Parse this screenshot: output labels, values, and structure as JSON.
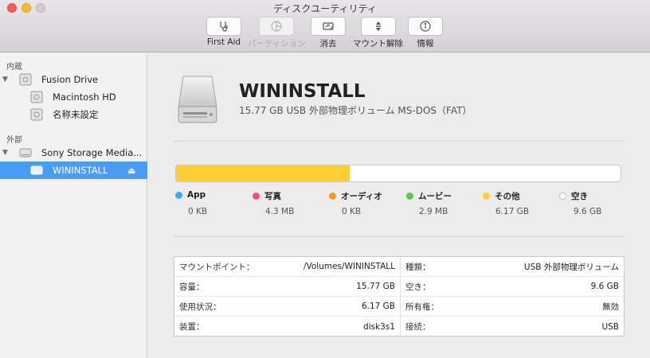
{
  "window": {
    "title": "ディスクユーティリティ"
  },
  "toolbar": {
    "first_aid": "First Aid",
    "partition": "パーティション",
    "erase": "消去",
    "unmount": "マウント解除",
    "info": "情報"
  },
  "sidebar": {
    "internal_label": "内蔵",
    "external_label": "外部",
    "items": [
      {
        "label": "Fusion Drive"
      },
      {
        "label": "Macintosh HD"
      },
      {
        "label": "名称未設定"
      },
      {
        "label": "Sony Storage Media..."
      },
      {
        "label": "WININSTALL"
      }
    ]
  },
  "volume": {
    "name": "WININSTALL",
    "subtitle": "15.77 GB USB 外部物理ボリューム MS-DOS（FAT）"
  },
  "usage": {
    "used_fraction": 0.39,
    "colors": {
      "app": "#3ea9f5",
      "photos": "#f24d82",
      "audio": "#f79a1c",
      "movies": "#5ec84c",
      "other": "#fecf34",
      "free": "#ffffff"
    },
    "legend": [
      {
        "label": "App",
        "value": "0 KB"
      },
      {
        "label": "写真",
        "value": "4.3 MB"
      },
      {
        "label": "オーディオ",
        "value": "0 KB"
      },
      {
        "label": "ムービー",
        "value": "2.9 MB"
      },
      {
        "label": "その他",
        "value": "6.17 GB"
      },
      {
        "label": "空き",
        "value": "9.6 GB"
      }
    ]
  },
  "info": {
    "left": [
      {
        "key": "マウントポイント：",
        "value": "/Volumes/WININSTALL"
      },
      {
        "key": "容量：",
        "value": "15.77 GB"
      },
      {
        "key": "使用状況：",
        "value": "6.17 GB"
      },
      {
        "key": "装置：",
        "value": "disk3s1"
      }
    ],
    "right": [
      {
        "key": "種類：",
        "value": "USB 外部物理ボリューム"
      },
      {
        "key": "空き：",
        "value": "9.6 GB"
      },
      {
        "key": "所有権：",
        "value": "無効"
      },
      {
        "key": "接続：",
        "value": "USB"
      }
    ]
  }
}
